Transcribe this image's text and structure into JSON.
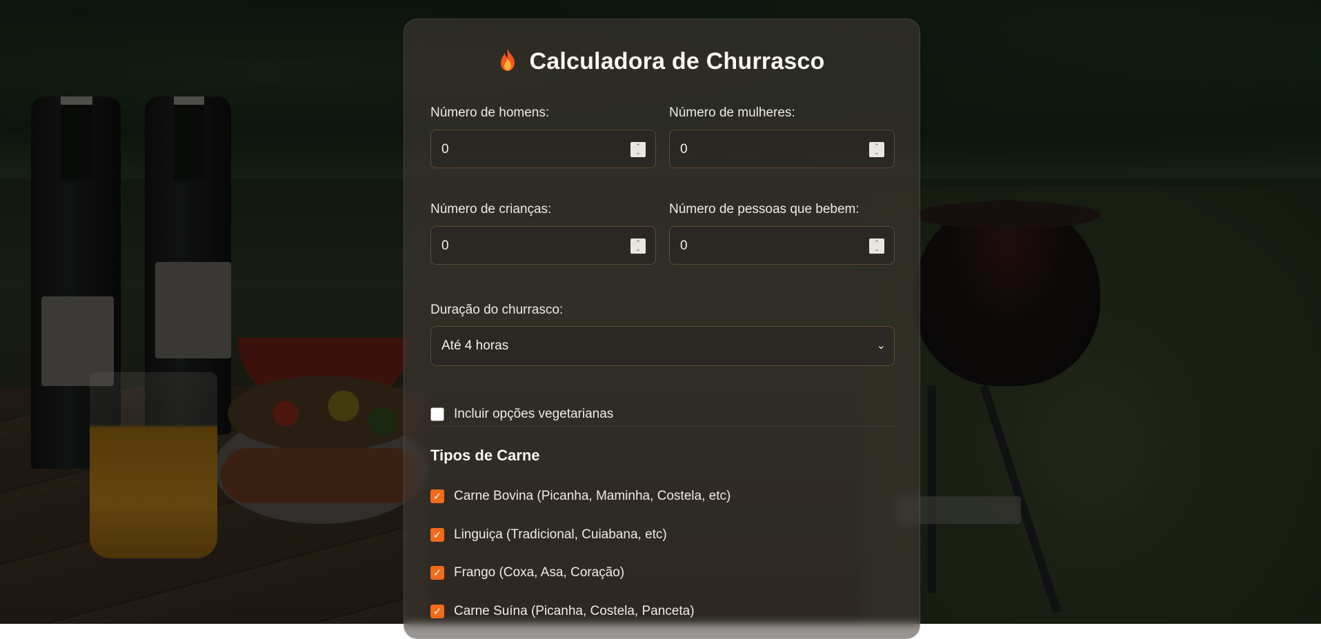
{
  "title": "Calculadora de Churrasco",
  "fields": {
    "men": {
      "label": "Número de homens:",
      "value": "0"
    },
    "women": {
      "label": "Número de mulheres:",
      "value": "0"
    },
    "children": {
      "label": "Número de crianças:",
      "value": "0"
    },
    "drinkers": {
      "label": "Número de pessoas que bebem:",
      "value": "0"
    }
  },
  "duration": {
    "label": "Duração do churrasco:",
    "selected": "Até 4 horas"
  },
  "vegetarian": {
    "label": "Incluir opções vegetarianas",
    "checked": false
  },
  "meat_section": {
    "title": "Tipos de Carne",
    "options": [
      {
        "label": "Carne Bovina (Picanha, Maminha, Costela, etc)",
        "checked": true
      },
      {
        "label": "Linguiça (Tradicional, Cuiabana, etc)",
        "checked": true
      },
      {
        "label": "Frango (Coxa, Asa, Coração)",
        "checked": true
      },
      {
        "label": "Carne Suína (Picanha, Costela, Panceta)",
        "checked": true
      }
    ]
  },
  "colors": {
    "accent": "#f26a1b",
    "card_bg": "rgba(70, 62, 56, 0.55)",
    "text": "#f3efe9"
  },
  "icons": {
    "title_icon": "fire-icon"
  }
}
